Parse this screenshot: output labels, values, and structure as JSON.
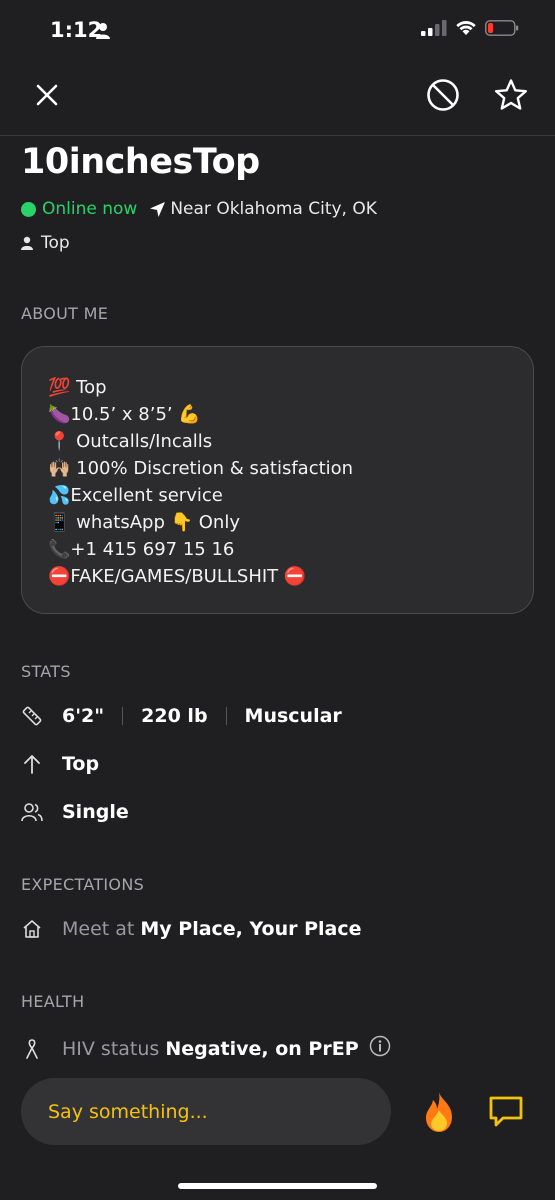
{
  "status_bar": {
    "time": "1:12",
    "battery_level": 0.15,
    "signal_bars": 2
  },
  "nav": {
    "icons": [
      "close-icon",
      "block-icon",
      "star-icon"
    ]
  },
  "profile": {
    "name": "10inchesTop",
    "online_status": "Online now",
    "location": "Near Oklahoma City, OK",
    "position": "Top",
    "online_color": "#29d36a"
  },
  "about": {
    "label": "ABOUT ME",
    "lines": [
      "💯 Top",
      "🍆10.5’ x 8’5’ 💪",
      "📍 Outcalls/Incalls",
      "🙌🏼 100% Discretion & satisfaction",
      "💦Excellent service",
      "📱 whatsApp 👇 Only",
      "📞+1 415 697 15 16",
      "⛔FAKE/GAMES/BULLSHIT ⛔"
    ]
  },
  "stats": {
    "label": "STATS",
    "height": "6'2\"",
    "weight": "220 lb",
    "body_type": "Muscular",
    "position": "Top",
    "relationship": "Single"
  },
  "expectations": {
    "label": "EXPECTATIONS",
    "prefix": "Meet at",
    "value": "My Place, Your Place"
  },
  "health": {
    "label": "HEALTH",
    "prefix": "HIV status",
    "value": "Negative, on PrEP"
  },
  "chat": {
    "placeholder": "Say something...",
    "accent_color": "#f4c20d"
  }
}
